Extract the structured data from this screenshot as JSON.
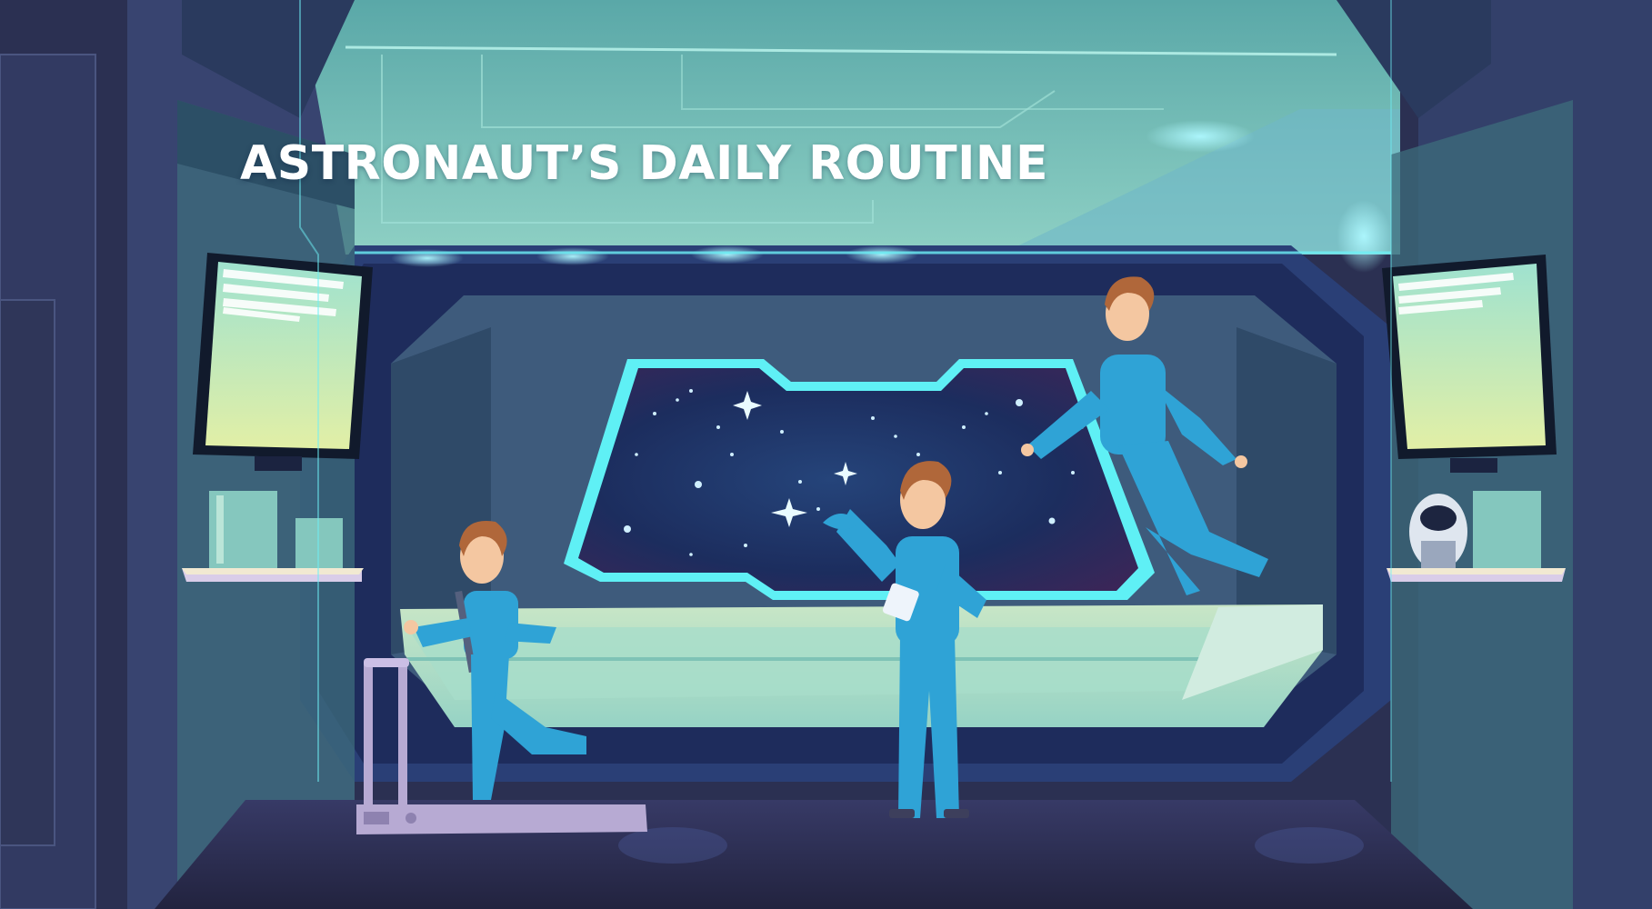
{
  "title": "ASTRONAUT’S DAILY ROUTINE",
  "colors": {
    "wall_dark": "#2b3052",
    "wall_mid": "#3a4770",
    "teal_panel": "#4f9ea6",
    "glow_cyan": "#5ff0f5",
    "space": "#1a2a55",
    "suit_blue": "#2fa3d6",
    "screen_top": "#9fe2cf",
    "screen_bottom": "#e2efa6",
    "skin": "#f4c7a1",
    "hair": "#b0673a",
    "treadmill": "#b7aad3",
    "floor": "#2d2f52"
  },
  "icons": [
    "monitor-left",
    "monitor-right",
    "star",
    "treadmill",
    "robot-pod",
    "book-stack"
  ]
}
